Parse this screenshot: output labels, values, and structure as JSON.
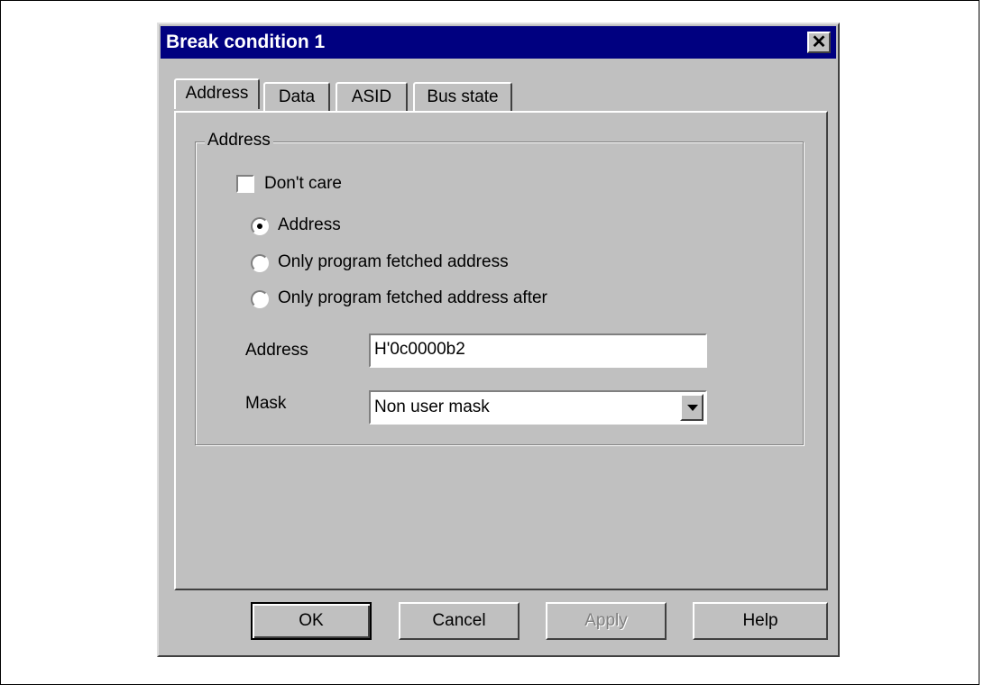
{
  "dialog": {
    "title": "Break condition 1",
    "close_glyph": "✕"
  },
  "tabs": [
    {
      "label": "Address",
      "active": true
    },
    {
      "label": "Data",
      "active": false
    },
    {
      "label": "ASID",
      "active": false
    },
    {
      "label": "Bus state",
      "active": false
    }
  ],
  "group": {
    "title": "Address",
    "dont_care_label": "Don't care",
    "dont_care_checked": false,
    "radios": [
      {
        "label": "Address",
        "selected": true
      },
      {
        "label": "Only program fetched address",
        "selected": false
      },
      {
        "label": "Only program fetched address after",
        "selected": false
      }
    ],
    "address_label": "Address",
    "address_value": "H'0c0000b2",
    "mask_label": "Mask",
    "mask_value": "Non user mask"
  },
  "buttons": {
    "ok": "OK",
    "cancel": "Cancel",
    "apply": "Apply",
    "help": "Help"
  },
  "colors": {
    "titlebar": "#000080",
    "face": "#c0c0c0"
  }
}
